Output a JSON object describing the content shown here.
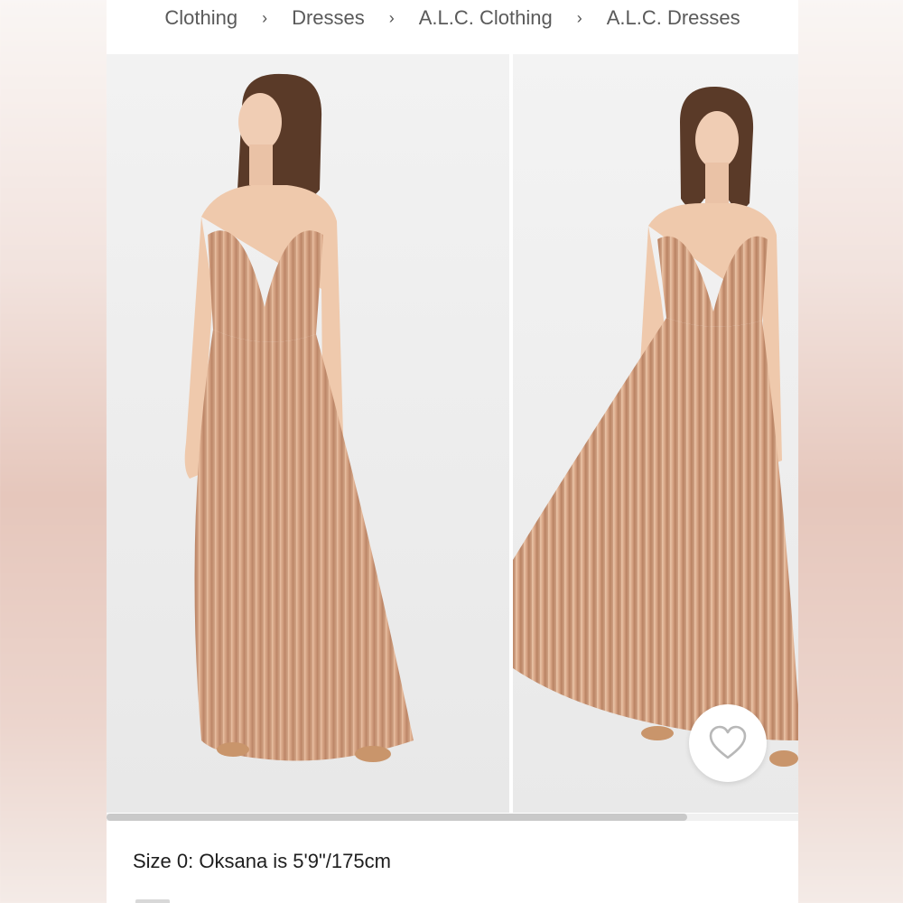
{
  "breadcrumb": {
    "items": [
      "Clothing",
      "Dresses",
      "A.L.C. Clothing",
      "A.L.C. Dresses"
    ],
    "separator": "›"
  },
  "gallery": {
    "images": [
      {
        "name": "product-photo-front",
        "alt": "Model in pleated satin maxi dress, standing"
      },
      {
        "name": "product-photo-motion",
        "alt": "Model in pleated satin maxi dress, skirt in motion"
      }
    ],
    "scroll_progress": 0.84
  },
  "favorite": {
    "icon": "heart-icon"
  },
  "caption": {
    "text": "Size 0: Oksana is 5'9\"/175cm"
  },
  "colors": {
    "dress": "#d9a98a",
    "background": "#efefef",
    "accent": "#b8b8b8"
  }
}
